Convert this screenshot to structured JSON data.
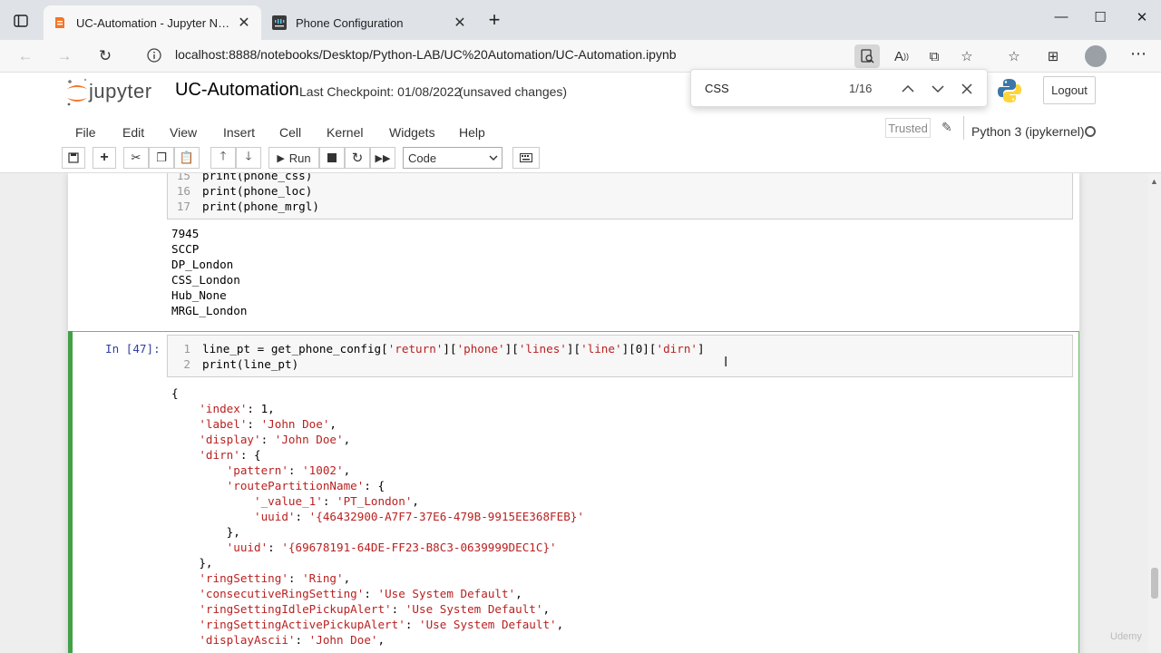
{
  "browser": {
    "tabs": [
      {
        "title": "UC-Automation - Jupyter Notebook",
        "active": true
      },
      {
        "title": "Phone Configuration",
        "active": false
      }
    ],
    "url": "localhost:8888/notebooks/Desktop/Python-LAB/UC%20Automation/UC-Automation.ipynb"
  },
  "find": {
    "query": "CSS",
    "count": "1/16"
  },
  "header": {
    "logo_text": "jupyter",
    "notebook_name": "UC-Automation",
    "checkpoint": "Last Checkpoint: 01/08/2022",
    "unsaved": "(unsaved changes)",
    "logout": "Logout"
  },
  "menu": [
    "File",
    "Edit",
    "View",
    "Insert",
    "Cell",
    "Kernel",
    "Widgets",
    "Help"
  ],
  "status": {
    "trusted": "Trusted",
    "kernel": "Python 3 (ipykernel)"
  },
  "toolbar": {
    "run_label": "Run",
    "cell_type": "Code"
  },
  "cell_prev": {
    "lines": [
      {
        "n": "15",
        "code": "print(phone_css)"
      },
      {
        "n": "16",
        "code": "print(phone_loc)"
      },
      {
        "n": "17",
        "code": "print(phone_mrgl)"
      }
    ],
    "output": [
      "7945",
      "SCCP",
      "DP_London",
      "CSS_London",
      "Hub_None",
      "MRGL_London"
    ]
  },
  "cell_current": {
    "prompt": "In [47]:",
    "lines": [
      {
        "n": "1",
        "code": "line_pt = get_phone_config['return']['phone']['lines']['line'][0]['dirn']"
      },
      {
        "n": "2",
        "code": "print(line_pt)"
      }
    ],
    "output": [
      "{",
      "    'index': 1,",
      "    'label': 'John Doe',",
      "    'display': 'John Doe',",
      "    'dirn': {",
      "        'pattern': '1002',",
      "        'routePartitionName': {",
      "            '_value_1': 'PT_London',",
      "            'uuid': '{46432900-A7F7-37E6-479B-9915EE368FEB}'",
      "        },",
      "        'uuid': '{69678191-64DE-FF23-B8C3-0639999DEC1C}'",
      "    },",
      "    'ringSetting': 'Ring',",
      "    'consecutiveRingSetting': 'Use System Default',",
      "    'ringSettingIdlePickupAlert': 'Use System Default',",
      "    'ringSettingActivePickupAlert': 'Use System Default',",
      "    'displayAscii': 'John Doe',"
    ]
  },
  "watermark": "Udemy"
}
